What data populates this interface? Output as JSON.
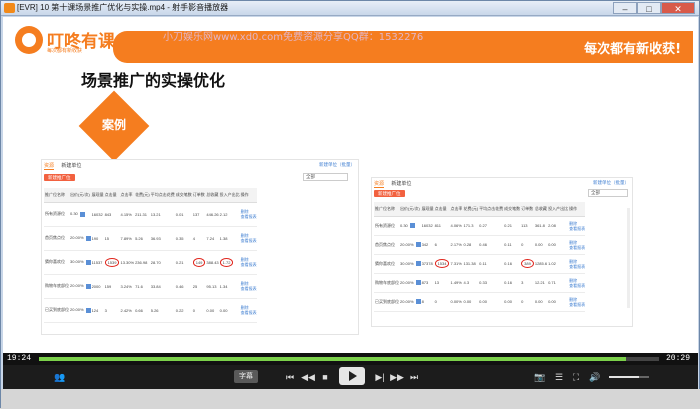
{
  "window": {
    "title": "[EVR] 10 第十课场景推广优化与实操.mp4 - 射手影音播放器",
    "minimize_glyph": "–",
    "maximize_glyph": "□",
    "close_glyph": "✕"
  },
  "slide": {
    "logo_name": "叮咚有课",
    "logo_tagline": "每次都有新收获",
    "watermark": "小刀娱乐网www.xd0.com免费资源分享QQ群：1532276",
    "banner_slogan": "每次都有新收获!",
    "title": "场景推广的实操优化",
    "case_label": "案例",
    "colors": {
      "brand_orange": "#f57d1f",
      "highlight_red": "#e0261d",
      "link_blue": "#3e7ed1"
    }
  },
  "panel_left": {
    "tabs": [
      "资源",
      "新建单位"
    ],
    "link": "新建单位（批量）",
    "add_button": "新建推广位",
    "select_value": "全部",
    "columns": [
      "推广位名称",
      "出价(元/次)",
      "展现量",
      "点击量",
      "点击率",
      "花费(元)",
      "平均点击花费",
      "成交笔数",
      "订单数",
      "总收藏",
      "投入产出比",
      "操作"
    ],
    "rows": [
      {
        "name": "所有资源位",
        "bid": "0.30",
        "impressions": "16032",
        "clicks": "843",
        "ctr": "4.15%",
        "cost": "211.31",
        "cpc": "13.21",
        "deals": "0.01",
        "orders": "137",
        "favs": "446.26",
        "roi": "2.12",
        "circled": []
      },
      {
        "name": "首页焦点位",
        "bid": "20.00%",
        "impressions": "190",
        "clicks": "15",
        "ctr": "7.89%",
        "cost": "5.26",
        "cpc": "36.93",
        "deals": "0.35",
        "orders": "4",
        "favs": "7.24",
        "roi": "1.38",
        "circled": []
      },
      {
        "name": "猜你喜欢位",
        "bid": "30.00%",
        "impressions": "11537",
        "clicks": "1539",
        "ctr": "13.30%",
        "cost": "236.98",
        "cpc": "28.70",
        "deals": "0.21",
        "orders": "149",
        "favs": "388.43",
        "roi": "1.72",
        "circled": [
          "clicks",
          "orders",
          "roi"
        ]
      },
      {
        "name": "购物车底部位",
        "bid": "20.00%",
        "impressions": "2000",
        "clicks": "159",
        "ctr": "3.24%",
        "cost": "71.6",
        "cpc": "33.84",
        "deals": "0.46",
        "orders": "25",
        "favs": "95.13",
        "roi": "1.34",
        "circled": []
      },
      {
        "name": "已买到底部位",
        "bid": "20.00%",
        "impressions": "124",
        "clicks": "3",
        "ctr": "2.42%",
        "cost": "0.66",
        "cpc": "5.26",
        "deals": "0.22",
        "orders": "0",
        "favs": "0.00",
        "roi": "0.00",
        "circled": []
      }
    ],
    "row_actions": [
      "删除",
      "查看报表"
    ]
  },
  "panel_right": {
    "tabs": [
      "资源",
      "新建单位"
    ],
    "link": "新建单位（批量）",
    "add_button": "新建推广位",
    "select_value": "全部",
    "columns": [
      "推广位名称",
      "出价(元/次)",
      "展现量",
      "点击量",
      "点击率",
      "花费(元)",
      "平均点击花费",
      "成交笔数",
      "订单数",
      "总收藏",
      "投入产出比",
      "操作"
    ],
    "rows": [
      {
        "name": "所有资源位",
        "bid": "0.30",
        "impressions": "16032",
        "clicks": "811",
        "ctr": "4.06%",
        "cost": "171.3",
        "cpc": "0.27",
        "deals": "0.21",
        "orders": "113",
        "favs": "361.8",
        "roi": "2.08",
        "circled": []
      },
      {
        "name": "首页焦点位",
        "bid": "20.00%",
        "impressions": "342",
        "clicks": "6",
        "ctr": "2.17%",
        "cost": "0.28",
        "cpc": "0.46",
        "deals": "0.11",
        "orders": "0",
        "favs": "0.00",
        "roi": "0.00",
        "circled": []
      },
      {
        "name": "猜你喜欢位",
        "bid": "30.00%",
        "impressions": "37378",
        "clicks": "1534",
        "ctr": "7.31%",
        "cost": "131.38",
        "cpc": "0.11",
        "deals": "0.16",
        "orders": "389",
        "favs": "1285.6",
        "roi": "1.02",
        "circled": [
          "clicks",
          "orders"
        ]
      },
      {
        "name": "购物车底部位",
        "bid": "20.00%",
        "impressions": "873",
        "clicks": "13",
        "ctr": "1.49%",
        "cost": "4.3",
        "cpc": "0.33",
        "deals": "0.16",
        "orders": "3",
        "favs": "12.21",
        "roi": "0.71",
        "circled": []
      },
      {
        "name": "已买到底部位",
        "bid": "20.00%",
        "impressions": "8",
        "clicks": "0",
        "ctr": "0.00%",
        "cost": "0.00",
        "cpc": "0.00",
        "deals": "0.00",
        "orders": "0",
        "favs": "0.00",
        "roi": "0.00",
        "circled": []
      }
    ],
    "row_actions": [
      "删除",
      "查看报表"
    ]
  },
  "player": {
    "time_elapsed": "19:24",
    "time_total": "20:29",
    "progress": 0.947,
    "subtitle_button": "字幕",
    "volume": 0.75,
    "controls": {
      "prev_chapter": "⏮",
      "rewind": "◀◀",
      "stop": "■",
      "step_forward": "▶|",
      "fast_forward": "▶▶",
      "next_chapter": "⏭",
      "screenshot": "📷",
      "playlist": "☰",
      "fullscreen": "⛶",
      "volume_icon": "🔊",
      "user_icon": "👥"
    }
  }
}
